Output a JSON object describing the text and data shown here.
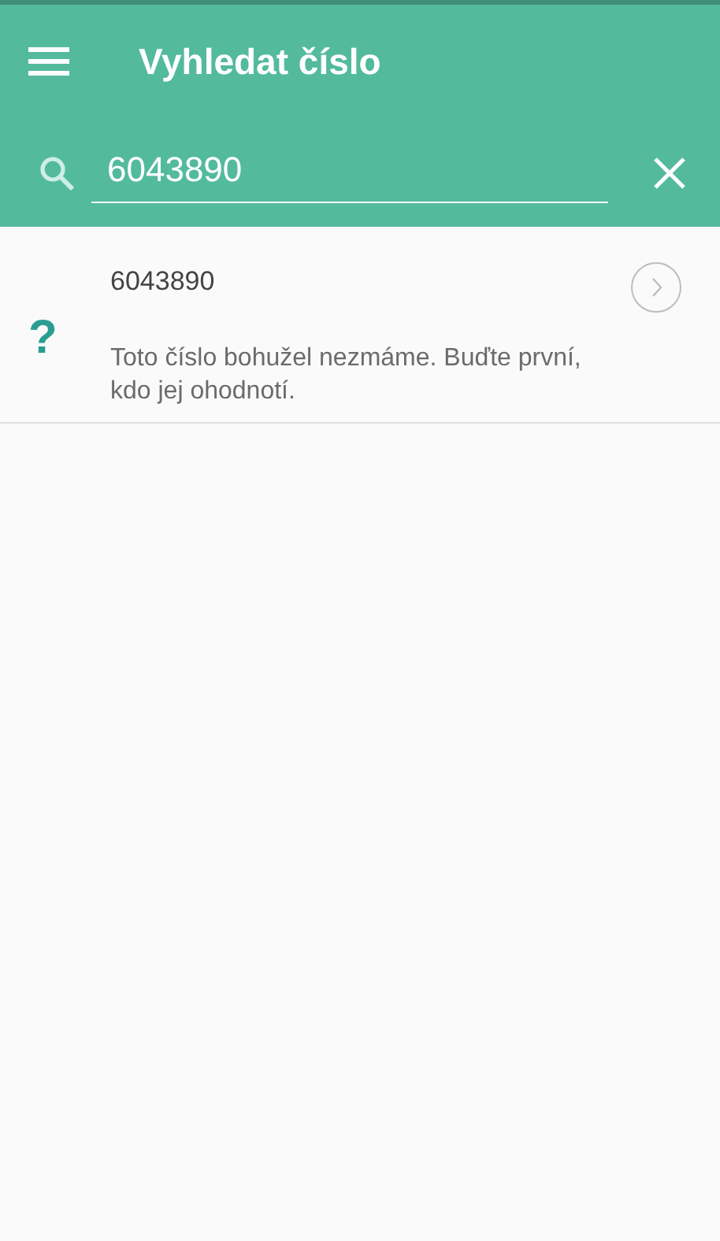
{
  "app_bar": {
    "title": "Vyhledat číslo"
  },
  "search": {
    "value": "6043890"
  },
  "results": [
    {
      "symbol": "?",
      "number": "6043890",
      "message": "Toto číslo bohužel nezmáme. Buďte první, kdo jej ohodnotí."
    }
  ]
}
